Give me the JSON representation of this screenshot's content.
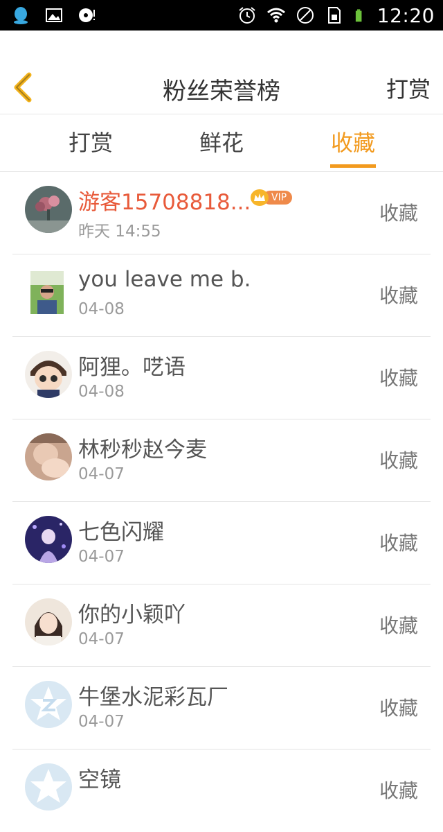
{
  "status_bar": {
    "time": "12:20",
    "left_icons": [
      "qq-icon",
      "image-icon",
      "music-disc-icon"
    ],
    "right_icons": [
      "alarm-icon",
      "wifi-icon",
      "dnd-icon",
      "sim-icon",
      "battery-icon"
    ]
  },
  "header": {
    "title": "粉丝荣誉榜",
    "action_label": "打赏"
  },
  "tabs": {
    "items": [
      {
        "label": "打赏",
        "active": false
      },
      {
        "label": "鲜花",
        "active": false
      },
      {
        "label": "收藏",
        "active": true
      }
    ]
  },
  "list": {
    "items": [
      {
        "name": "游客15708818...",
        "time": "昨天 14:55",
        "action": "收藏",
        "vip": "VIP"
      },
      {
        "name": "you leave me b.",
        "time": "04-08",
        "action": "收藏"
      },
      {
        "name": "阿狸。呓语",
        "time": "04-08",
        "action": "收藏"
      },
      {
        "name": "林秒秒赵今麦",
        "time": "04-07",
        "action": "收藏"
      },
      {
        "name": "七色闪耀",
        "time": "04-07",
        "action": "收藏"
      },
      {
        "name": "你的小颖吖",
        "time": "04-07",
        "action": "收藏"
      },
      {
        "name": "牛堡水泥彩瓦厂",
        "time": "04-07",
        "action": "收藏"
      },
      {
        "name": "空镜",
        "time": "",
        "action": "收藏"
      }
    ]
  },
  "colors": {
    "accent": "#f29a1e",
    "highlight_name": "#e85a3a",
    "text": "#555555",
    "muted": "#9a9a9a"
  }
}
